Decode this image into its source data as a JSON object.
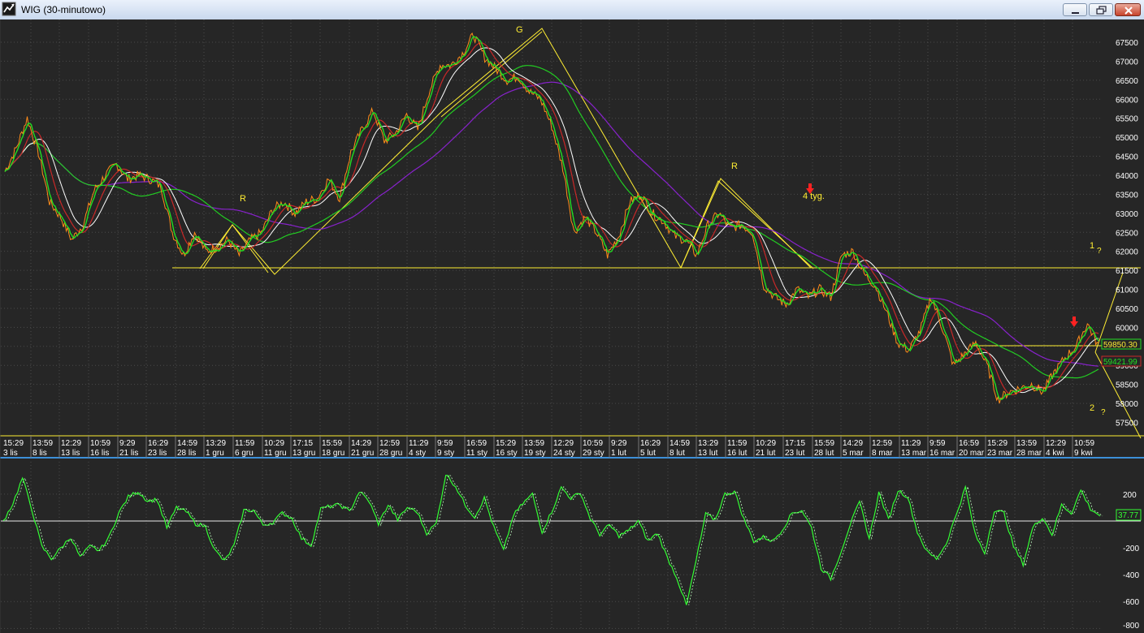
{
  "window": {
    "title": "WIG (30-minutowo)",
    "buttons": [
      "minimize",
      "restore",
      "close"
    ]
  },
  "colors": {
    "background": "#262626",
    "grid": "#4a4a4a",
    "axis_text": "#ffffff",
    "price": "#ff8c1a",
    "ma_fast": "#22dd22",
    "ma_red": "#c82828",
    "ma_white": "#ffffff",
    "ma_long_green": "#22cc22",
    "ma_purple": "#8822cc",
    "annotation": "#ffee33",
    "marker": "#ff2222",
    "oscillator": "#33ff33"
  },
  "chart_data": [
    {
      "type": "line",
      "title": "",
      "ylim": [
        57500,
        67900
      ],
      "yticks": [
        58000,
        58500,
        59000,
        59500,
        60000,
        60500,
        61000,
        61500,
        62000,
        62500,
        63000,
        63500,
        64000,
        64500,
        65000,
        65500,
        66000,
        66500,
        67000,
        67500
      ],
      "y_tick_labels_shown": [
        "67500",
        "67000",
        "66500",
        "66000",
        "65500",
        "65000",
        "64500",
        "64000",
        "63500",
        "63000",
        "62500",
        "62000",
        "61500",
        "61000",
        "60500",
        "60000",
        "59000",
        "58500",
        "58000",
        "57500"
      ],
      "x_time_labels": [
        "15:29",
        "13:59",
        "12:29",
        "10:59",
        "9:29",
        "16:29",
        "14:59",
        "13:29",
        "11:59",
        "10:29",
        "17:15",
        "15:59",
        "14:29",
        "12:59",
        "11:29",
        "9:59",
        "16:59",
        "15:29",
        "13:59",
        "12:29",
        "10:59",
        "9:29",
        "16:29",
        "14:59",
        "13:29",
        "11:59",
        "10:29",
        "17:15",
        "15:59",
        "14:29",
        "12:59",
        "11:29",
        "9:59",
        "16:59",
        "15:29",
        "13:59",
        "12:29",
        "10:59"
      ],
      "x_date_labels": [
        "3 lis",
        "8 lis",
        "13 lis",
        "16 lis",
        "21 lis",
        "23 lis",
        "28 lis",
        "1 gru",
        "6 gru",
        "11 gru",
        "13 gru",
        "18 gru",
        "21 gru",
        "28 gru",
        "4 sty",
        "9 sty",
        "11 sty",
        "16 sty",
        "19 sty",
        "24 sty",
        "29 sty",
        "1 lut",
        "5 lut",
        "8 lut",
        "13 lut",
        "16 lut",
        "21 lut",
        "23 lut",
        "28 lut",
        "5 mar",
        "8 mar",
        "13 mar",
        "16 mar",
        "20 mar",
        "23 mar",
        "28 mar",
        "4 kwi",
        "9 kwi"
      ],
      "price_path": [
        [
          0,
          64100
        ],
        [
          1,
          64700
        ],
        [
          2,
          65500
        ],
        [
          3,
          64600
        ],
        [
          4,
          63300
        ],
        [
          5,
          62900
        ],
        [
          6,
          62300
        ],
        [
          7,
          62700
        ],
        [
          8,
          63600
        ],
        [
          9,
          64000
        ],
        [
          10,
          64300
        ],
        [
          11,
          63900
        ],
        [
          12,
          64000
        ],
        [
          13,
          63900
        ],
        [
          14,
          63700
        ],
        [
          15,
          62500
        ],
        [
          16,
          61900
        ],
        [
          17,
          62500
        ],
        [
          18,
          62000
        ],
        [
          19,
          62100
        ],
        [
          20,
          62300
        ],
        [
          21,
          61900
        ],
        [
          22,
          62300
        ],
        [
          23,
          62500
        ],
        [
          24,
          63100
        ],
        [
          25,
          63300
        ],
        [
          26,
          63000
        ],
        [
          27,
          63300
        ],
        [
          28,
          63400
        ],
        [
          29,
          63900
        ],
        [
          30,
          63400
        ],
        [
          31,
          64600
        ],
        [
          32,
          65200
        ],
        [
          33,
          65700
        ],
        [
          34,
          64900
        ],
        [
          35,
          65100
        ],
        [
          36,
          65600
        ],
        [
          37,
          65200
        ],
        [
          38,
          66200
        ],
        [
          39,
          66900
        ],
        [
          40,
          66900
        ],
        [
          41,
          67200
        ],
        [
          42,
          67700
        ],
        [
          43,
          67100
        ],
        [
          44,
          66800
        ],
        [
          45,
          66500
        ],
        [
          46,
          66600
        ],
        [
          47,
          66200
        ],
        [
          48,
          66000
        ],
        [
          49,
          65300
        ],
        [
          50,
          64200
        ],
        [
          51,
          62500
        ],
        [
          52,
          62900
        ],
        [
          53,
          62500
        ],
        [
          54,
          61900
        ],
        [
          55,
          62400
        ],
        [
          56,
          63300
        ],
        [
          57,
          63500
        ],
        [
          58,
          63000
        ],
        [
          59,
          62800
        ],
        [
          60,
          62400
        ],
        [
          61,
          62300
        ],
        [
          62,
          61900
        ],
        [
          63,
          62700
        ],
        [
          64,
          63000
        ],
        [
          65,
          62600
        ],
        [
          66,
          62700
        ],
        [
          67,
          62500
        ],
        [
          68,
          61100
        ],
        [
          69,
          60800
        ],
        [
          70,
          60600
        ],
        [
          71,
          61000
        ],
        [
          72,
          60800
        ],
        [
          73,
          61000
        ],
        [
          74,
          60800
        ],
        [
          75,
          61900
        ],
        [
          76,
          62000
        ],
        [
          77,
          61400
        ],
        [
          78,
          61100
        ],
        [
          79,
          60400
        ],
        [
          80,
          59600
        ],
        [
          81,
          59400
        ],
        [
          82,
          59900
        ],
        [
          83,
          60800
        ],
        [
          84,
          60000
        ],
        [
          85,
          59000
        ],
        [
          86,
          59300
        ],
        [
          87,
          59600
        ],
        [
          88,
          59000
        ],
        [
          89,
          58100
        ],
        [
          90,
          58300
        ],
        [
          91,
          58400
        ],
        [
          92,
          58500
        ],
        [
          93,
          58300
        ],
        [
          94,
          58800
        ],
        [
          95,
          59200
        ],
        [
          96,
          59500
        ],
        [
          97,
          60100
        ],
        [
          98,
          59500
        ]
      ],
      "annotations": [
        "G",
        "R",
        "R",
        "4 tyg.",
        "1",
        "?",
        "2",
        "?"
      ],
      "price_labels": [
        "59850.30",
        "59421.99"
      ]
    },
    {
      "type": "line",
      "title": "",
      "ylim": [
        -800,
        300
      ],
      "yticks": [
        200,
        -200,
        -400,
        -600,
        -800
      ],
      "y_tick_labels_shown": [
        "200",
        "-200",
        "-400",
        "-600",
        "-800"
      ],
      "current_value_label": "37.77",
      "osc_path": [
        [
          0,
          0
        ],
        [
          1,
          130
        ],
        [
          2,
          320
        ],
        [
          3,
          80
        ],
        [
          4,
          -190
        ],
        [
          5,
          -280
        ],
        [
          6,
          -200
        ],
        [
          7,
          -120
        ],
        [
          8,
          -270
        ],
        [
          9,
          -190
        ],
        [
          10,
          -220
        ],
        [
          11,
          -120
        ],
        [
          12,
          60
        ],
        [
          13,
          180
        ],
        [
          14,
          220
        ],
        [
          15,
          150
        ],
        [
          16,
          160
        ],
        [
          17,
          -50
        ],
        [
          18,
          100
        ],
        [
          19,
          70
        ],
        [
          20,
          -20
        ],
        [
          21,
          -40
        ],
        [
          22,
          -220
        ],
        [
          23,
          -300
        ],
        [
          24,
          -180
        ],
        [
          25,
          80
        ],
        [
          26,
          80
        ],
        [
          27,
          -30
        ],
        [
          28,
          -10
        ],
        [
          29,
          60
        ],
        [
          30,
          20
        ],
        [
          31,
          -130
        ],
        [
          32,
          -180
        ],
        [
          33,
          90
        ],
        [
          34,
          110
        ],
        [
          35,
          120
        ],
        [
          36,
          70
        ],
        [
          37,
          220
        ],
        [
          38,
          150
        ],
        [
          39,
          -20
        ],
        [
          40,
          120
        ],
        [
          41,
          10
        ],
        [
          42,
          100
        ],
        [
          43,
          70
        ],
        [
          44,
          -90
        ],
        [
          45,
          -20
        ],
        [
          46,
          350
        ],
        [
          47,
          260
        ],
        [
          48,
          120
        ],
        [
          49,
          30
        ],
        [
          50,
          170
        ],
        [
          51,
          -50
        ],
        [
          52,
          -220
        ],
        [
          53,
          40
        ],
        [
          54,
          130
        ],
        [
          55,
          200
        ],
        [
          56,
          -80
        ],
        [
          57,
          70
        ],
        [
          58,
          250
        ],
        [
          59,
          170
        ],
        [
          60,
          210
        ],
        [
          61,
          20
        ],
        [
          62,
          -100
        ],
        [
          63,
          -30
        ],
        [
          64,
          -110
        ],
        [
          65,
          -70
        ],
        [
          66,
          0
        ],
        [
          67,
          -150
        ],
        [
          68,
          -90
        ],
        [
          69,
          -270
        ],
        [
          70,
          -420
        ],
        [
          71,
          -630
        ],
        [
          72,
          -300
        ],
        [
          73,
          50
        ],
        [
          74,
          10
        ],
        [
          75,
          200
        ],
        [
          76,
          220
        ],
        [
          77,
          10
        ],
        [
          78,
          -150
        ],
        [
          79,
          -120
        ],
        [
          80,
          -150
        ],
        [
          81,
          -60
        ],
        [
          82,
          60
        ],
        [
          83,
          80
        ],
        [
          84,
          -50
        ],
        [
          85,
          -350
        ],
        [
          86,
          -430
        ],
        [
          87,
          -240
        ],
        [
          88,
          -30
        ],
        [
          89,
          140
        ],
        [
          90,
          -130
        ],
        [
          91,
          210
        ],
        [
          92,
          10
        ],
        [
          93,
          230
        ],
        [
          94,
          180
        ],
        [
          95,
          -80
        ],
        [
          96,
          -230
        ],
        [
          97,
          -280
        ],
        [
          98,
          -170
        ],
        [
          99,
          40
        ],
        [
          100,
          250
        ],
        [
          101,
          -100
        ],
        [
          102,
          -240
        ],
        [
          103,
          80
        ],
        [
          104,
          60
        ],
        [
          105,
          -190
        ],
        [
          106,
          -320
        ],
        [
          107,
          -50
        ],
        [
          108,
          30
        ],
        [
          109,
          -100
        ],
        [
          110,
          120
        ],
        [
          111,
          60
        ],
        [
          112,
          230
        ],
        [
          113,
          90
        ],
        [
          114,
          40
        ]
      ]
    }
  ]
}
